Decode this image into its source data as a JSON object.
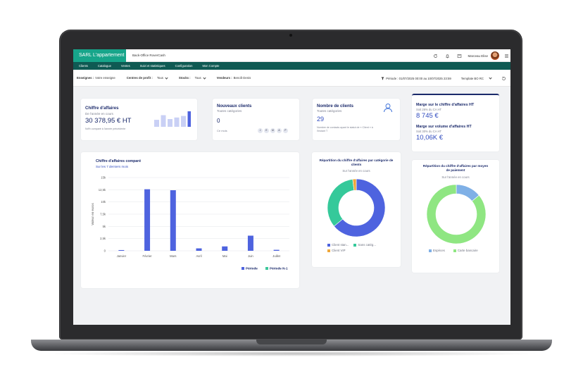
{
  "header": {
    "brand": "SARL L'appartement",
    "app_name": "Back-Office RoverCash",
    "user_name": "Marceau Elise"
  },
  "nav": {
    "items": [
      "Clients",
      "Catalogue",
      "Ventes",
      "Suivi et statistiques",
      "Configuration",
      "Mon Compte"
    ]
  },
  "filters": {
    "enseignes_label": "Enseignes :",
    "enseignes_value": "Votre enseigne",
    "centres_label": "Centres de profit :",
    "centres_value": "Tous",
    "stocks_label": "Stocks :",
    "stocks_value": "Tous",
    "vendeurs_label": "Vendeurs :",
    "vendeurs_value": "Benoît Denis",
    "period": "Période : 01/07/2025 00:00 au 10/07/2025 23:59",
    "template": "Template BO RC"
  },
  "cards": {
    "ca": {
      "title": "Chiffre d'affaires",
      "subtitle": "De l'année en cours",
      "value": "30 378,95 € HT",
      "note": "Nd% comparé à l'année précédente",
      "bars": [
        0.45,
        0.75,
        0.5,
        0.6,
        0.7,
        1.0
      ]
    },
    "new_clients": {
      "title": "Nouveaux clients",
      "subtitle": "Toutes catégories",
      "value": "0",
      "period": "Ce mois",
      "badges": [
        "J",
        "E",
        "M",
        "A",
        "P"
      ]
    },
    "nb_clients": {
      "title": "Nombre de clients",
      "subtitle": "Toutes catégories",
      "value": "29",
      "note": "Nombre de contacts ayant le statut de « Client » à l'instant T"
    },
    "marge": {
      "title1": "Marge sur le chiffre d'affaires HT",
      "sub1": "Soit 26% du CA HT",
      "value1": "8 745 €",
      "title2": "Marge sur volume d'affaires HT",
      "sub2": "Soit 30% du CA HT",
      "value2": "10,06K €"
    }
  },
  "chart_data": [
    {
      "type": "bar",
      "title": "Chiffre d'affaires comparé",
      "subtitle": "Sur les 7 derniers mois",
      "ylabel": "Valeur en euros",
      "categories": [
        "Janvier",
        "Février",
        "Mars",
        "Avril",
        "Mai",
        "Juin",
        "Juillet"
      ],
      "series": [
        {
          "name": "Période",
          "color": "#4e63df",
          "values": [
            150,
            12600,
            12400,
            500,
            900,
            3100,
            200
          ]
        },
        {
          "name": "Période N-1",
          "color": "#3cc79a",
          "values": [
            0,
            0,
            0,
            0,
            0,
            0,
            0
          ]
        }
      ],
      "ylim": [
        0,
        15000
      ],
      "yticks": [
        0,
        2500,
        5000,
        7500,
        10000,
        12500,
        15000
      ],
      "ytick_labels": [
        "0",
        "2,5k",
        "5k",
        "7,5k",
        "10k",
        "12,5k",
        "15k"
      ]
    },
    {
      "type": "pie",
      "title": "Répartition du chiffre d'affaires par catégorie de clients",
      "subtitle": "Sur l'année en cours",
      "labels": [
        "Client stan...",
        "Sans catég...",
        "Client VIP"
      ],
      "values": [
        64,
        34,
        2
      ],
      "colors": [
        "#4e63df",
        "#35c99a",
        "#f0a73a"
      ]
    },
    {
      "type": "pie",
      "title": "Répartition du chiffre d'affaires par moyen de paiement",
      "subtitle": "Sur l'année en cours",
      "labels": [
        "Espèces",
        "Carte bancaire"
      ],
      "values": [
        14,
        86
      ],
      "colors": [
        "#7fb0e6",
        "#8fe682"
      ]
    }
  ]
}
